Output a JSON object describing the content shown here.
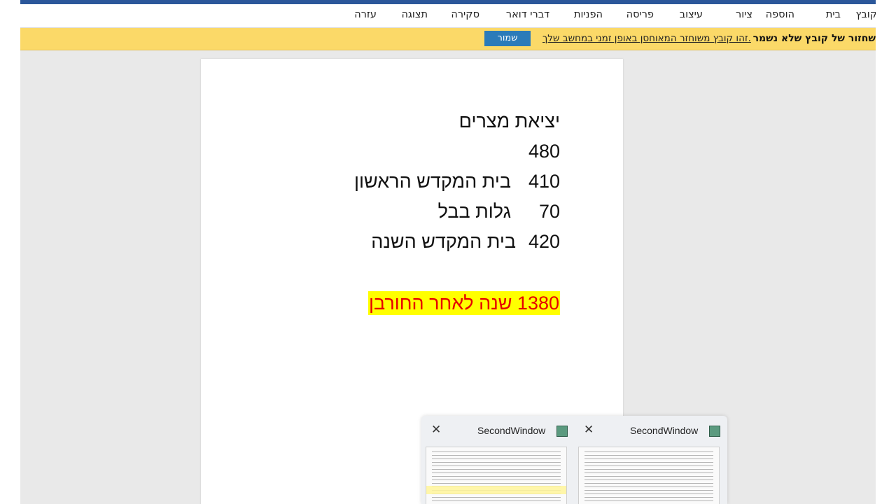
{
  "ribbon": {
    "tabs": [
      "קובץ",
      "בית",
      "הוספה",
      "ציור",
      "עיצוב",
      "פריסה",
      "הפניות",
      "דברי דואר",
      "סקירה",
      "תצוגה",
      "עזרה"
    ]
  },
  "notification": {
    "title": "שחזור של קובץ שלא נשמר",
    "message": "זהו קובץ משוחזר המאוחסן באופן זמני במחשב שלך.",
    "save_label": "שמור"
  },
  "document": {
    "heading": "יציאת מצרים",
    "rows": [
      {
        "number": "480",
        "label": ""
      },
      {
        "number": "410",
        "label": "בית המקדש הראשון"
      },
      {
        "number": "70",
        "label": "גלות בבל"
      },
      {
        "number": "420",
        "label": "בית המקדש השנה"
      }
    ],
    "highlighted": "1380 שנה לאחר החורבן"
  },
  "taskbar_previews": [
    {
      "title": "SecondWindow",
      "close": "✕"
    },
    {
      "title": "SecondWindow",
      "close": "✕"
    }
  ],
  "colors": {
    "ribbon_accent": "#2b579a",
    "notification_bg": "#fbd968",
    "save_button": "#2b7bb9",
    "highlight_bg": "#ffff00",
    "highlight_text": "#e60000"
  }
}
